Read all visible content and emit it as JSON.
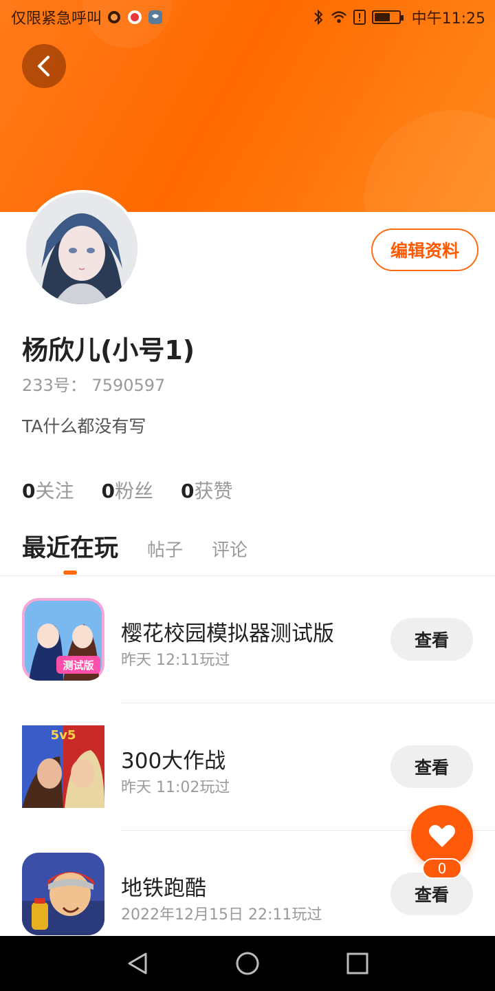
{
  "status_bar": {
    "carrier_text": "仅限紧急呼叫",
    "time": "中午11:25"
  },
  "profile": {
    "name": "杨欣儿(小号1)",
    "id_line": "233号： 7590597",
    "bio": "TA什么都没有写",
    "edit_label": "编辑资料"
  },
  "stats": [
    {
      "value": "0",
      "label": "关注"
    },
    {
      "value": "0",
      "label": "粉丝"
    },
    {
      "value": "0",
      "label": "获赞"
    }
  ],
  "tabs": [
    "最近在玩",
    "帖子",
    "评论"
  ],
  "games": [
    {
      "title": "樱花校园模拟器测试版",
      "time": "昨天 12:11玩过",
      "button": "查看",
      "icon_text": "测试版"
    },
    {
      "title": "300大作战",
      "time": "昨天 11:02玩过",
      "button": "查看",
      "icon_text": "5v5"
    },
    {
      "title": "地铁跑酷",
      "time": "2022年12月15日 22:11玩过",
      "button": "查看",
      "icon_text": ""
    }
  ],
  "like_fab": {
    "count": "0"
  },
  "colors": {
    "accent": "#ff6a10",
    "header_start": "#ff7a1a",
    "header_end": "#ff8a1e"
  }
}
